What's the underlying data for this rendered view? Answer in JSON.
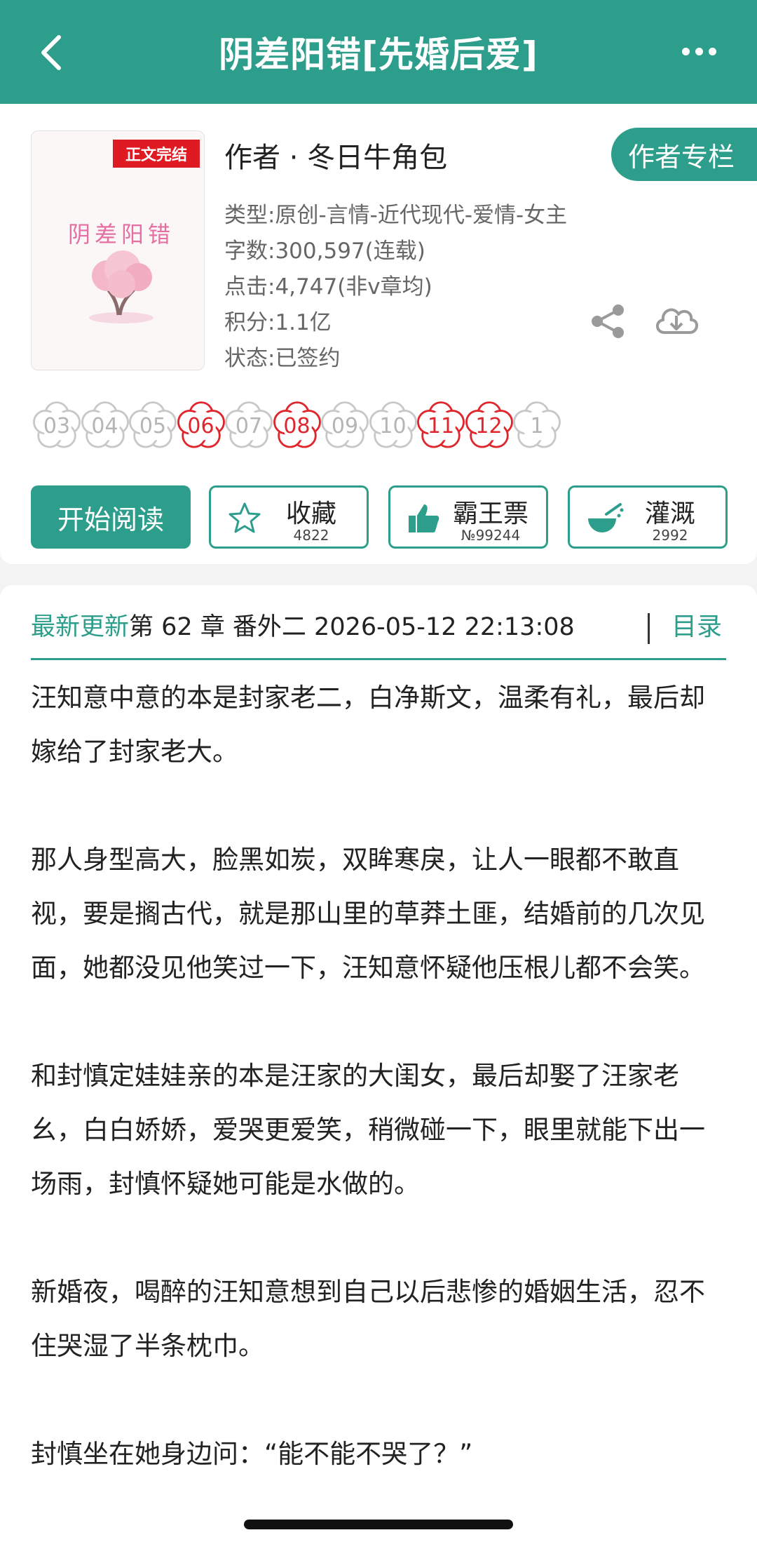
{
  "header": {
    "title": "阴差阳错[先婚后爱]"
  },
  "book": {
    "cover_badge": "正文完结",
    "cover_title": "阴差阳错",
    "author": "作者 · 冬日牛角包",
    "author_column_button": "作者专栏",
    "meta": {
      "type": "类型:原创-言情-近代现代-爱情-女主",
      "words": "字数:300,597(连载)",
      "clicks": "点击:4,747(非v章均)",
      "score": "积分:1.1亿",
      "status": "状态:已签约"
    },
    "months": [
      {
        "label": "03",
        "active": false
      },
      {
        "label": "04",
        "active": false
      },
      {
        "label": "05",
        "active": false
      },
      {
        "label": "06",
        "active": true
      },
      {
        "label": "07",
        "active": false
      },
      {
        "label": "08",
        "active": true
      },
      {
        "label": "09",
        "active": false
      },
      {
        "label": "10",
        "active": false
      },
      {
        "label": "11",
        "active": true
      },
      {
        "label": "12",
        "active": true
      },
      {
        "label": "1",
        "active": false
      }
    ],
    "actions": {
      "read": "开始阅读",
      "favorite_label": "收藏",
      "favorite_count": "4822",
      "ticket_label": "霸王票",
      "ticket_count": "№99244",
      "water_label": "灌溉",
      "water_count": "2992"
    }
  },
  "update": {
    "latest_label": "最新更新",
    "chapter": "第 62 章 番外二 2026-05-12 22:13:08",
    "toc_label": "目录"
  },
  "synopsis": [
    "汪知意中意的本是封家老二，白净斯文，温柔有礼，最后却嫁给了封家老大。",
    "那人身型高大，脸黑如炭，双眸寒戾，让人一眼都不敢直视，要是搁古代，就是那山里的草莽土匪，结婚前的几次见面，她都没见他笑过一下，汪知意怀疑他压根儿都不会笑。",
    "和封慎定娃娃亲的本是汪家的大闺女，最后却娶了汪家老幺，白白娇娇，爱哭更爱笑，稍微碰一下，眼里就能下出一场雨，封慎怀疑她可能是水做的。",
    "新婚夜，喝醉的汪知意想到自己以后悲惨的婚姻生活，忍不住哭湿了半条枕巾。",
    "封慎坐在她身边问：“能不能不哭了？”"
  ],
  "colors": {
    "accent": "#2e9e8c",
    "badge_red": "#e01a22",
    "flower_active": "#e0262d",
    "flower_inactive": "#c8c8c8"
  },
  "icons": {
    "back": "chevron-left-icon",
    "more": "more-dots-icon",
    "share": "share-icon",
    "download": "cloud-download-icon",
    "favorite": "star-icon",
    "ticket": "thumbs-up-icon",
    "water": "watering-bowl-icon",
    "month": "flower-icon"
  }
}
